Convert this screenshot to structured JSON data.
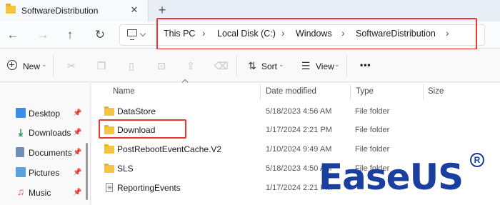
{
  "tab": {
    "title": "SoftwareDistribution",
    "close": "✕",
    "new": "+"
  },
  "nav": {
    "back": "←",
    "forward": "→",
    "up": "↑",
    "refresh": "↻"
  },
  "breadcrumb": {
    "items": [
      "This PC",
      "Local Disk (C:)",
      "Windows",
      "SoftwareDistribution"
    ],
    "separator": "›"
  },
  "toolbar": {
    "new_label": "New",
    "sort_label": "Sort",
    "view_label": "View",
    "more": "•••"
  },
  "sidebar": {
    "items": [
      {
        "label": "Desktop",
        "icon": "desktop-icon"
      },
      {
        "label": "Downloads",
        "icon": "downloads-icon"
      },
      {
        "label": "Documents",
        "icon": "documents-icon"
      },
      {
        "label": "Pictures",
        "icon": "pictures-icon"
      },
      {
        "label": "Music",
        "icon": "music-icon"
      }
    ],
    "pin": "📌"
  },
  "columns": {
    "name": "Name",
    "date": "Date modified",
    "type": "Type",
    "size": "Size"
  },
  "files": [
    {
      "name": "DataStore",
      "date": "5/18/2023 4:56 AM",
      "type": "File folder",
      "icon": "folder-icon"
    },
    {
      "name": "Download",
      "date": "1/17/2024 2:21 PM",
      "type": "File folder",
      "icon": "folder-icon"
    },
    {
      "name": "PostRebootEventCache.V2",
      "date": "1/10/2024 9:49 AM",
      "type": "File folder",
      "icon": "folder-icon"
    },
    {
      "name": "SLS",
      "date": "5/18/2023 4:50 AM",
      "type": "File folder",
      "icon": "folder-icon"
    },
    {
      "name": "ReportingEvents",
      "date": "1/17/2024 2:21 PM",
      "type": "",
      "icon": "file-icon"
    }
  ],
  "watermark": {
    "text": "EaseUS",
    "mark": "R"
  },
  "colors": {
    "highlight": "#e53935",
    "brand": "#1b3f9f",
    "folder": "#f4c542"
  }
}
